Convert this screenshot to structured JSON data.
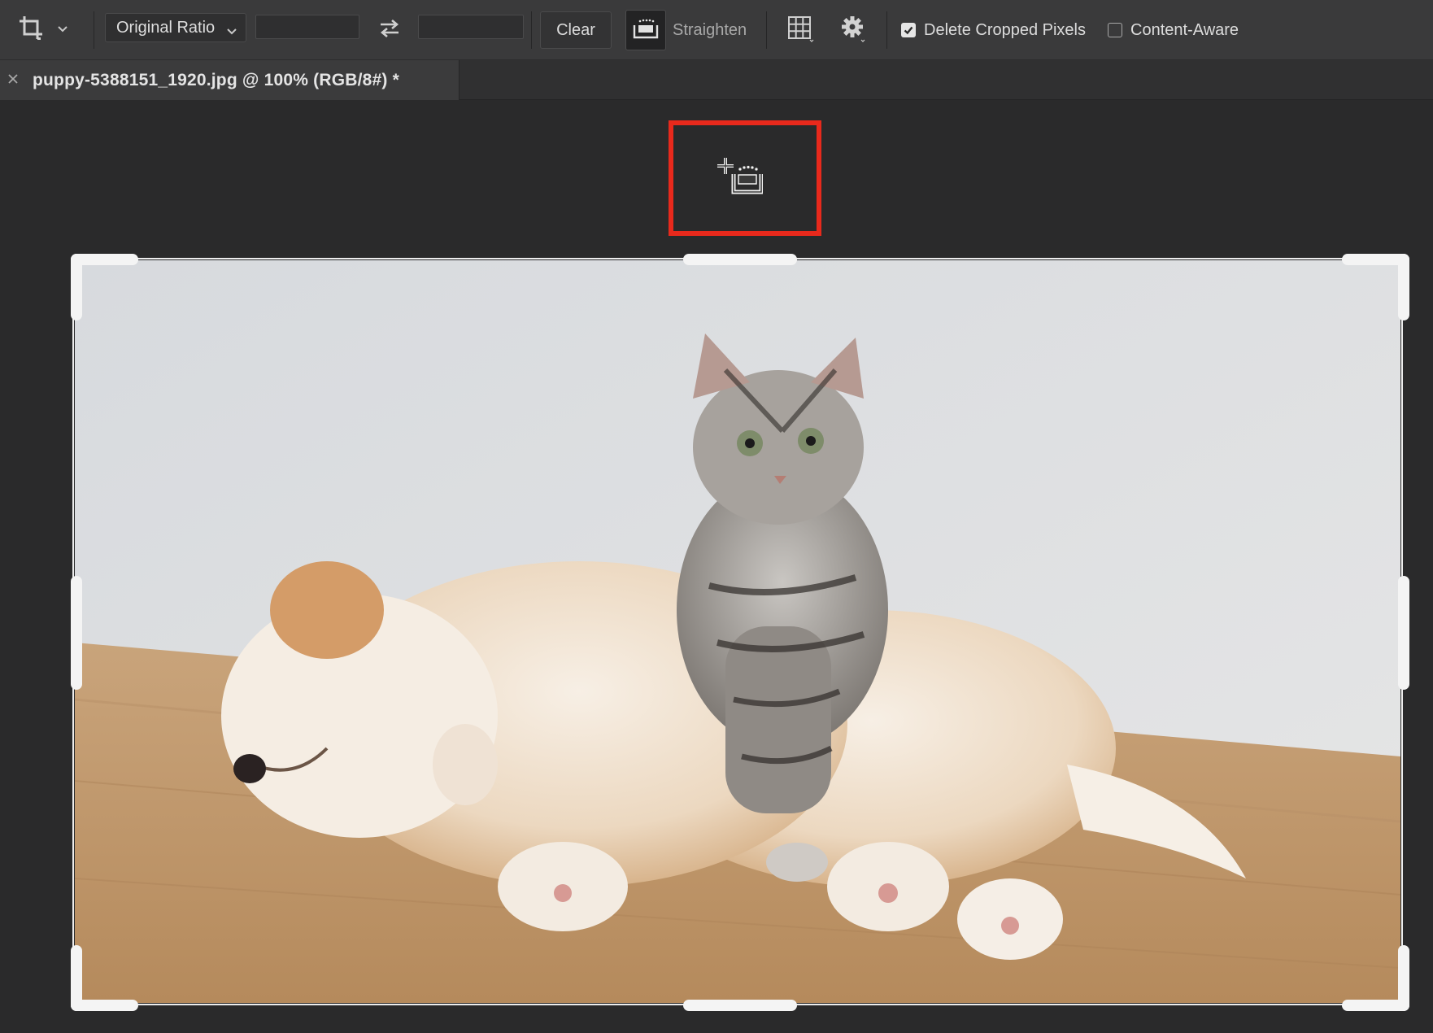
{
  "toolbar": {
    "crop_tool_icon": "crop-icon",
    "ratio_select_value": "Original Ratio",
    "width_value": "",
    "height_value": "",
    "swap_icon": "swap-arrows-icon",
    "clear_label": "Clear",
    "straighten_icon": "straighten-level-icon",
    "straighten_label": "Straighten",
    "overlay_icon": "grid-overlay-icon",
    "settings_icon": "gear-icon",
    "delete_cropped_label": "Delete Cropped Pixels",
    "delete_cropped_checked": true,
    "content_aware_label": "Content-Aware",
    "content_aware_checked": false
  },
  "tab": {
    "title": "puppy-5388151_1920.jpg @ 100% (RGB/8#) *"
  },
  "canvas": {
    "cursor_icon": "straighten-cursor-icon",
    "highlight_color": "#e8291c",
    "image": "photo of a sleeping puppy with a tabby kitten"
  }
}
